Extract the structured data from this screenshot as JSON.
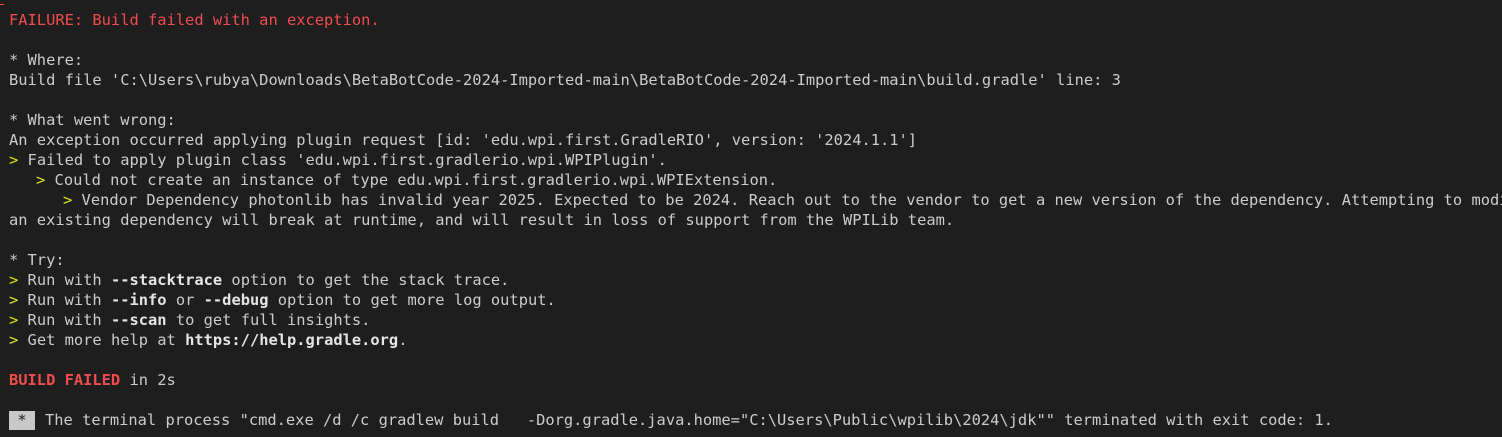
{
  "failure_header": "FAILURE: Build failed with an exception.",
  "where": {
    "heading": "* Where:",
    "detail": "Build file 'C:\\Users\\rubya\\Downloads\\BetaBotCode-2024-Imported-main\\BetaBotCode-2024-Imported-main\\build.gradle' line: 3"
  },
  "wrong": {
    "heading": "* What went wrong:",
    "detail": "An exception occurred applying plugin request [id: 'edu.wpi.first.GradleRIO', version: '2024.1.1']",
    "causes": [
      {
        "marker": "> ",
        "text": "Failed to apply plugin class 'edu.wpi.first.gradlerio.wpi.WPIPlugin'."
      },
      {
        "marker": "> ",
        "text": "Could not create an instance of type edu.wpi.first.gradlerio.wpi.WPIExtension."
      },
      {
        "marker": "> ",
        "text": "Vendor Dependency photonlib has invalid year 2025. Expected to be 2024. Reach out to the vendor to get a new version of the dependency. Attempting to modify"
      }
    ],
    "cause_continuation": "an existing dependency will break at runtime, and will result in loss of support from the WPILib team."
  },
  "try": {
    "heading": "* Try:",
    "items": [
      {
        "marker": "> ",
        "pre": "Run with ",
        "b1": "--stacktrace",
        "mid": " option to get the stack trace.",
        "b2": "",
        "post": ""
      },
      {
        "marker": "> ",
        "pre": "Run with ",
        "b1": "--info",
        "mid": " or ",
        "b2": "--debug",
        "post": " option to get more log output."
      },
      {
        "marker": "> ",
        "pre": "Run with ",
        "b1": "--scan",
        "mid": " to get full insights.",
        "b2": "",
        "post": ""
      },
      {
        "marker": "> ",
        "pre": "Get more help at ",
        "b1": "https://help.gradle.org",
        "mid": ".",
        "b2": "",
        "post": ""
      }
    ]
  },
  "result": {
    "status": "BUILD FAILED",
    "duration": " in 2s"
  },
  "task_end": {
    "badge": "*",
    "message": "The terminal process \"cmd.exe /d /c gradlew build   -Dorg.gradle.java.home=\"C:\\Users\\Public\\wpilib\\2024\\jdk\"\" terminated with exit code: 1."
  },
  "colors": {
    "background": "#1e1e1e",
    "text": "#cccccc",
    "error": "#f14c4c",
    "marker": "#e5e510"
  }
}
